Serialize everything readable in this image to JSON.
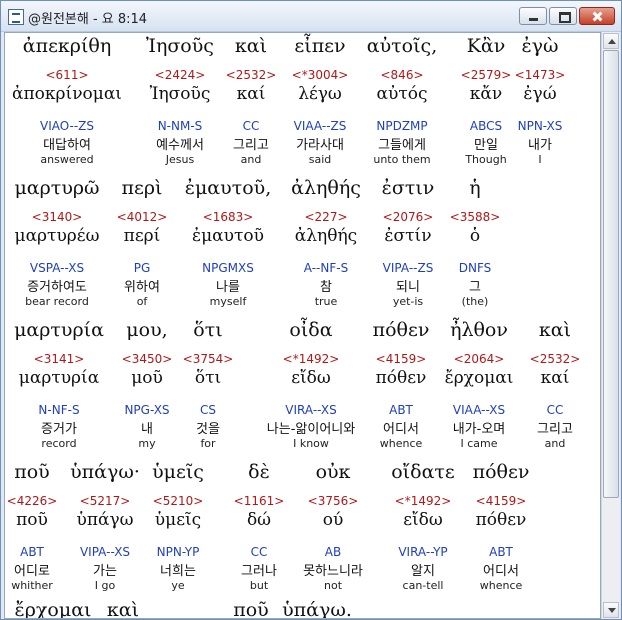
{
  "window": {
    "title": "@원전본해 - 요 8:14"
  },
  "rows": [
    {
      "words": [
        {
          "greek": "ἀπεκρίθη",
          "num": "<611>",
          "lemma": "ἀποκρίνομαι",
          "parse": "VIAO--ZS",
          "kor": "대답하여",
          "eng": "answered"
        },
        {
          "greek": "Ἰησοῦς",
          "num": "<2424>",
          "lemma": "Ἰησοῦς",
          "parse": "N-NM-S",
          "kor": "예수께서",
          "eng": "Jesus"
        },
        {
          "greek": "καὶ",
          "num": "<2532>",
          "lemma": "καί",
          "parse": "CC",
          "kor": "그리고",
          "eng": "and"
        },
        {
          "greek": "εἶπεν",
          "num": "<*3004>",
          "lemma": "λέγω",
          "parse": "VIAA--ZS",
          "kor": "가라사대",
          "eng": "said"
        },
        {
          "greek": "αὐτοῖς,",
          "num": "<846>",
          "lemma": "αὐτός",
          "parse": "NPDZMP",
          "kor": "그들에게",
          "eng": "unto them"
        },
        {
          "greek": "Κἂν",
          "num": "<2579>",
          "lemma": "κἄν",
          "parse": "ABCS",
          "kor": "만일",
          "eng": "Though"
        },
        {
          "greek": "ἐγὼ",
          "num": "<1473>",
          "lemma": "ἐγώ",
          "parse": "NPN-XS",
          "kor": "내가",
          "eng": "I"
        }
      ]
    },
    {
      "words": [
        {
          "greek": "μαρτυρῶ",
          "num": "<3140>",
          "lemma": "μαρτυρέω",
          "parse": "VSPA--XS",
          "kor": "증거하여도",
          "eng": "bear record"
        },
        {
          "greek": "περὶ",
          "num": "<4012>",
          "lemma": "περί",
          "parse": "PG",
          "kor": "위하여",
          "eng": "of"
        },
        {
          "greek": "ἐμαυτοῦ,",
          "num": "<1683>",
          "lemma": "ἐμαυτοῦ",
          "parse": "NPGMXS",
          "kor": "나를",
          "eng": "myself"
        },
        {
          "greek": "ἀληθής",
          "num": "<227>",
          "lemma": "ἀληθής",
          "parse": "A--NF-S",
          "kor": "참",
          "eng": "true"
        },
        {
          "greek": "ἐστιν",
          "num": "<2076>",
          "lemma": "ἐστίν",
          "parse": "VIPA--ZS",
          "kor": "되니",
          "eng": "yet-is"
        },
        {
          "greek": "ἡ",
          "num": "<3588>",
          "lemma": "ὁ",
          "parse": "DNFS",
          "kor": "그",
          "eng": "(the)"
        }
      ]
    },
    {
      "words": [
        {
          "greek": "μαρτυρία",
          "num": "<3141>",
          "lemma": "μαρτυρία",
          "parse": "N-NF-S",
          "kor": "증거가",
          "eng": "record"
        },
        {
          "greek": "μου,",
          "num": "<3450>",
          "lemma": "μοῦ",
          "parse": "NPG-XS",
          "kor": "내",
          "eng": "my"
        },
        {
          "greek": "ὅτι",
          "num": "<3754>",
          "lemma": "ὅτι",
          "parse": "CS",
          "kor": "것을",
          "eng": "for"
        },
        {
          "greek": "οἶδα",
          "num": "<*1492>",
          "lemma": "εἴδω",
          "parse": "VIRA--XS",
          "kor": "나는-앎이어니와",
          "eng": "I know"
        },
        {
          "greek": "πόθεν",
          "num": "<4159>",
          "lemma": "πόθεν",
          "parse": "ABT",
          "kor": "어디서",
          "eng": "whence"
        },
        {
          "greek": "ἦλθον",
          "num": "<2064>",
          "lemma": "ἔρχομαι",
          "parse": "VIAA--XS",
          "kor": "내가-오며",
          "eng": "I came"
        },
        {
          "greek": "καὶ",
          "num": "<2532>",
          "lemma": "καί",
          "parse": "CC",
          "kor": "그리고",
          "eng": "and"
        }
      ]
    },
    {
      "words": [
        {
          "greek": "ποῦ",
          "num": "<4226>",
          "lemma": "ποῦ",
          "parse": "ABT",
          "kor": "어디로",
          "eng": "whither"
        },
        {
          "greek": "ὑπάγω·",
          "num": "<5217>",
          "lemma": "ὑπάγω",
          "parse": "VIPA--XS",
          "kor": "가는",
          "eng": "I go"
        },
        {
          "greek": "ὑμεῖς",
          "num": "<5210>",
          "lemma": "ὑμεῖς",
          "parse": "NPN-YP",
          "kor": "너희는",
          "eng": "ye"
        },
        {
          "greek": "δὲ",
          "num": "<1161>",
          "lemma": "δώ",
          "parse": "CC",
          "kor": "그러나",
          "eng": "but"
        },
        {
          "greek": "οὐκ",
          "num": "<3756>",
          "lemma": "ού",
          "parse": "AB",
          "kor": "못하느니라",
          "eng": "not"
        },
        {
          "greek": "οἴδατε",
          "num": "<*1492>",
          "lemma": "εἴδω",
          "parse": "VIRA--YP",
          "kor": "알지",
          "eng": "can-tell"
        },
        {
          "greek": "πόθεν",
          "num": "<4159>",
          "lemma": "πόθεν",
          "parse": "ABT",
          "kor": "어디서",
          "eng": "whence"
        }
      ]
    },
    {
      "words": [
        {
          "greek": "ἔρχομαι"
        },
        {
          "greek": "καὶ"
        },
        {
          "greek": "ποῦ"
        },
        {
          "greek": "ὑπάγω."
        }
      ]
    }
  ]
}
